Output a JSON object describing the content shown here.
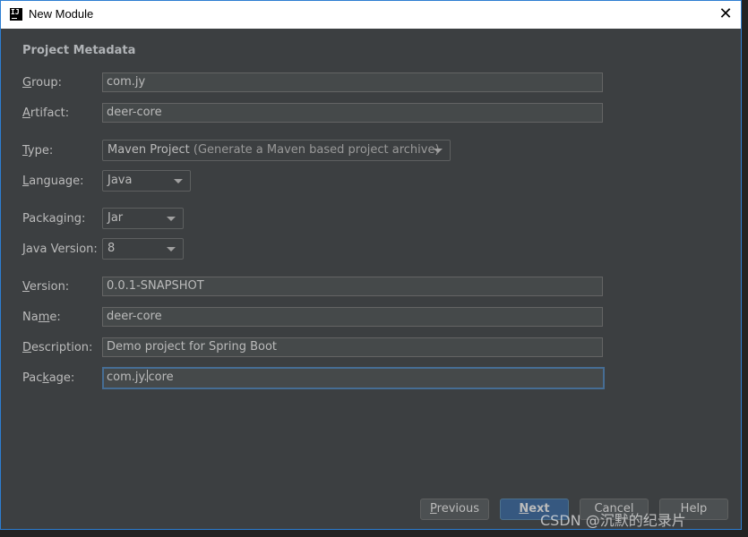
{
  "window": {
    "title": "New Module",
    "app_icon": "intellij-idea-icon",
    "close_icon": "close-icon"
  },
  "form": {
    "section_title": "Project Metadata",
    "group": {
      "label_pre": "",
      "label_mnemonic": "G",
      "label_post": "roup:",
      "value": "com.jy"
    },
    "artifact": {
      "label_pre": "",
      "label_mnemonic": "A",
      "label_post": "rtifact:",
      "value": "deer-core"
    },
    "type": {
      "label_pre": "",
      "label_mnemonic": "T",
      "label_post": "ype:",
      "value": "Maven Project",
      "hint": "(Generate a Maven based project archive)"
    },
    "language": {
      "label_pre": "",
      "label_mnemonic": "L",
      "label_post": "anguage:",
      "value": "Java"
    },
    "packaging": {
      "label_pre": "Packa",
      "label_mnemonic": "g",
      "label_post": "ing:",
      "value": "Jar"
    },
    "java_version": {
      "label_pre": "",
      "label_mnemonic": "J",
      "label_post": "ava Version:",
      "value": "8"
    },
    "version": {
      "label_pre": "",
      "label_mnemonic": "V",
      "label_post": "ersion:",
      "value": "0.0.1-SNAPSHOT"
    },
    "name": {
      "label_pre": "Na",
      "label_mnemonic": "m",
      "label_post": "e:",
      "value": "deer-core"
    },
    "description": {
      "label_pre": "",
      "label_mnemonic": "D",
      "label_post": "escription:",
      "value": "Demo project for Spring Boot"
    },
    "package": {
      "label_pre": "Pac",
      "label_mnemonic": "k",
      "label_post": "age:",
      "value_before_caret": "com.jy.",
      "value_after_caret": "core"
    }
  },
  "buttons": {
    "previous": {
      "mnemonic": "P",
      "rest": "revious"
    },
    "next": {
      "mnemonic": "N",
      "rest": "ext"
    },
    "cancel": {
      "label": "Cancel"
    },
    "help": {
      "label": "Help"
    }
  },
  "watermark": "CSDN @沉默的纪录片"
}
